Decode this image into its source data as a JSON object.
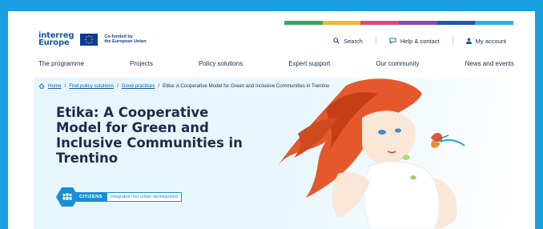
{
  "brand": {
    "logo_line1": "interreg",
    "logo_line2": "Europe",
    "eu_line1": "Co-funded by",
    "eu_line2": "the European Union"
  },
  "colors": {
    "accent_blue": "#1a8ed1",
    "top_strip": [
      "#3aa35b",
      "#f2b632",
      "#e3447a",
      "#8a4bb5",
      "#1d57b8",
      "#2bb3e3"
    ]
  },
  "utility_nav": {
    "search": "Search",
    "help": "Help & contact",
    "account": "My account"
  },
  "main_nav": [
    {
      "label": "The programme"
    },
    {
      "label": "Projects"
    },
    {
      "label": "Policy solutions"
    },
    {
      "label": "Expert support"
    },
    {
      "label": "Our community"
    },
    {
      "label": "News and events"
    }
  ],
  "breadcrumb": {
    "home": "Home",
    "sep": "/",
    "items": [
      "Find policy solutions",
      "Good practices"
    ],
    "current": "Etika: A Cooperative Model for Green and Inclusive Communities in Trentino"
  },
  "page": {
    "title": "Etika: A Cooperative Model for Green and Inclusive Communities in Trentino",
    "tag": "CITIZENS",
    "tag_sub": "Integrated non-urban development"
  }
}
